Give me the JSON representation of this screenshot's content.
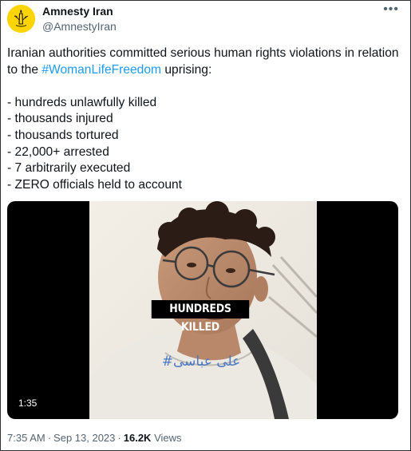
{
  "author": {
    "display_name": "Amnesty Iran",
    "handle": "@AmnestyIran"
  },
  "tweet": {
    "intro": "Iranian authorities committed serious human rights violations in relation to the ",
    "hashtag": "#WomanLifeFreedom",
    "intro_end": " uprising:",
    "list": [
      "- hundreds unlawfully killed",
      "- thousands injured",
      "- thousands tortured",
      "- 22,000+ arrested",
      "- 7 arbitrarily executed",
      "- ZERO officials held to account"
    ]
  },
  "media": {
    "caption": "HUNDREDS KILLED",
    "handwritten_text": "#علی عباسی",
    "duration": "1:35"
  },
  "meta": {
    "time": "7:35 AM",
    "date": "Sep 13, 2023",
    "views_count": "16.2K",
    "views_label": "Views",
    "separator": "·"
  },
  "icons": {
    "more": "more-horizontal-icon",
    "avatar": "amnesty-candle-logo"
  },
  "colors": {
    "link": "#1d9bf0",
    "text": "#0f1419",
    "secondary": "#536471",
    "avatar_bg": "#ffd400"
  }
}
